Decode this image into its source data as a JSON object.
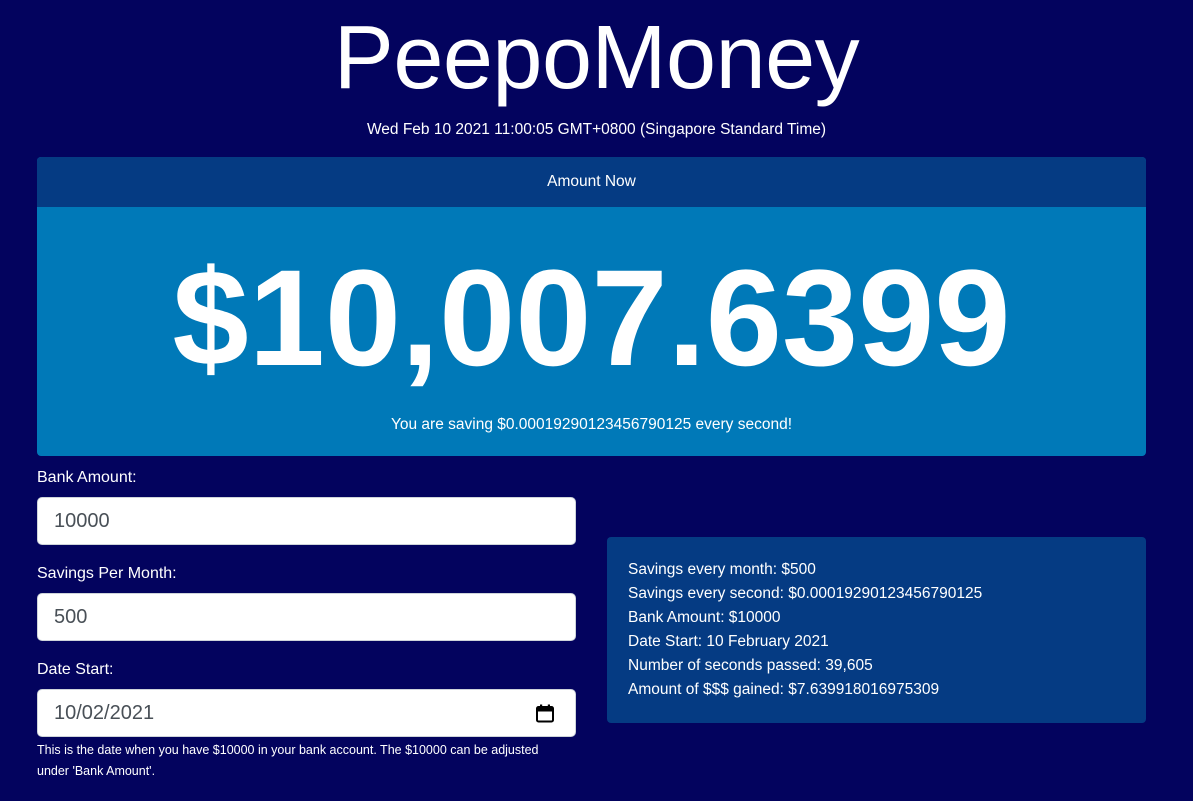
{
  "app": {
    "title": "PeepoMoney",
    "datetime": "Wed Feb 10 2021 11:00:05 GMT+0800 (Singapore Standard Time)"
  },
  "amount_card": {
    "header": "Amount Now",
    "amount": "$10,007.6399",
    "saving_rate_text": "You are saving $0.00019290123456790125 every second!"
  },
  "form": {
    "bank_amount": {
      "label": "Bank Amount:",
      "value": "10000"
    },
    "savings_per_month": {
      "label": "Savings Per Month:",
      "value": "500"
    },
    "date_start": {
      "label": "Date Start:",
      "value": "10/02/2021",
      "icon": "calendar-icon",
      "help": "This is the date when you have $10000 in your bank account. The $10000 can be adjusted under 'Bank Amount'."
    }
  },
  "summary": {
    "lines": [
      "Savings every month: $500",
      "Savings every second: $0.00019290123456790125",
      "Bank Amount: $10000",
      "Date Start: 10 February 2021",
      "Number of seconds passed: 39,605",
      "Amount of $$$ gained: $7.639918016975309"
    ]
  },
  "colors": {
    "background": "#03035e",
    "panel": "#053b83",
    "accent": "#0079b8",
    "text": "#ffffff",
    "input_text": "#495057"
  }
}
